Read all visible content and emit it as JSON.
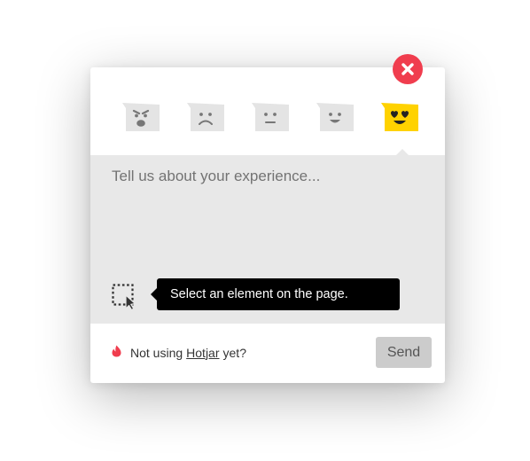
{
  "widget": {
    "ratings": [
      {
        "name": "hate",
        "icon": "angry-face-icon",
        "selected": false
      },
      {
        "name": "dislike",
        "icon": "sad-face-icon",
        "selected": false
      },
      {
        "name": "neutral",
        "icon": "neutral-face-icon",
        "selected": false
      },
      {
        "name": "like",
        "icon": "smile-face-icon",
        "selected": false
      },
      {
        "name": "love",
        "icon": "heart-eyes-face-icon",
        "selected": true
      }
    ],
    "feedback": {
      "placeholder": "Tell us about your experience...",
      "value": ""
    },
    "tooltip": {
      "text": "Select an element on the page."
    },
    "footer": {
      "prefix": "Not using",
      "link": "Hotjar",
      "suffix": "yet?",
      "send_label": "Send"
    },
    "colors": {
      "accent": "#f03d4e",
      "selected": "#ffd200",
      "unselected": "#e4e4e4",
      "feedback_bg": "#e8e8e8",
      "send_bg": "#cccccc"
    }
  }
}
